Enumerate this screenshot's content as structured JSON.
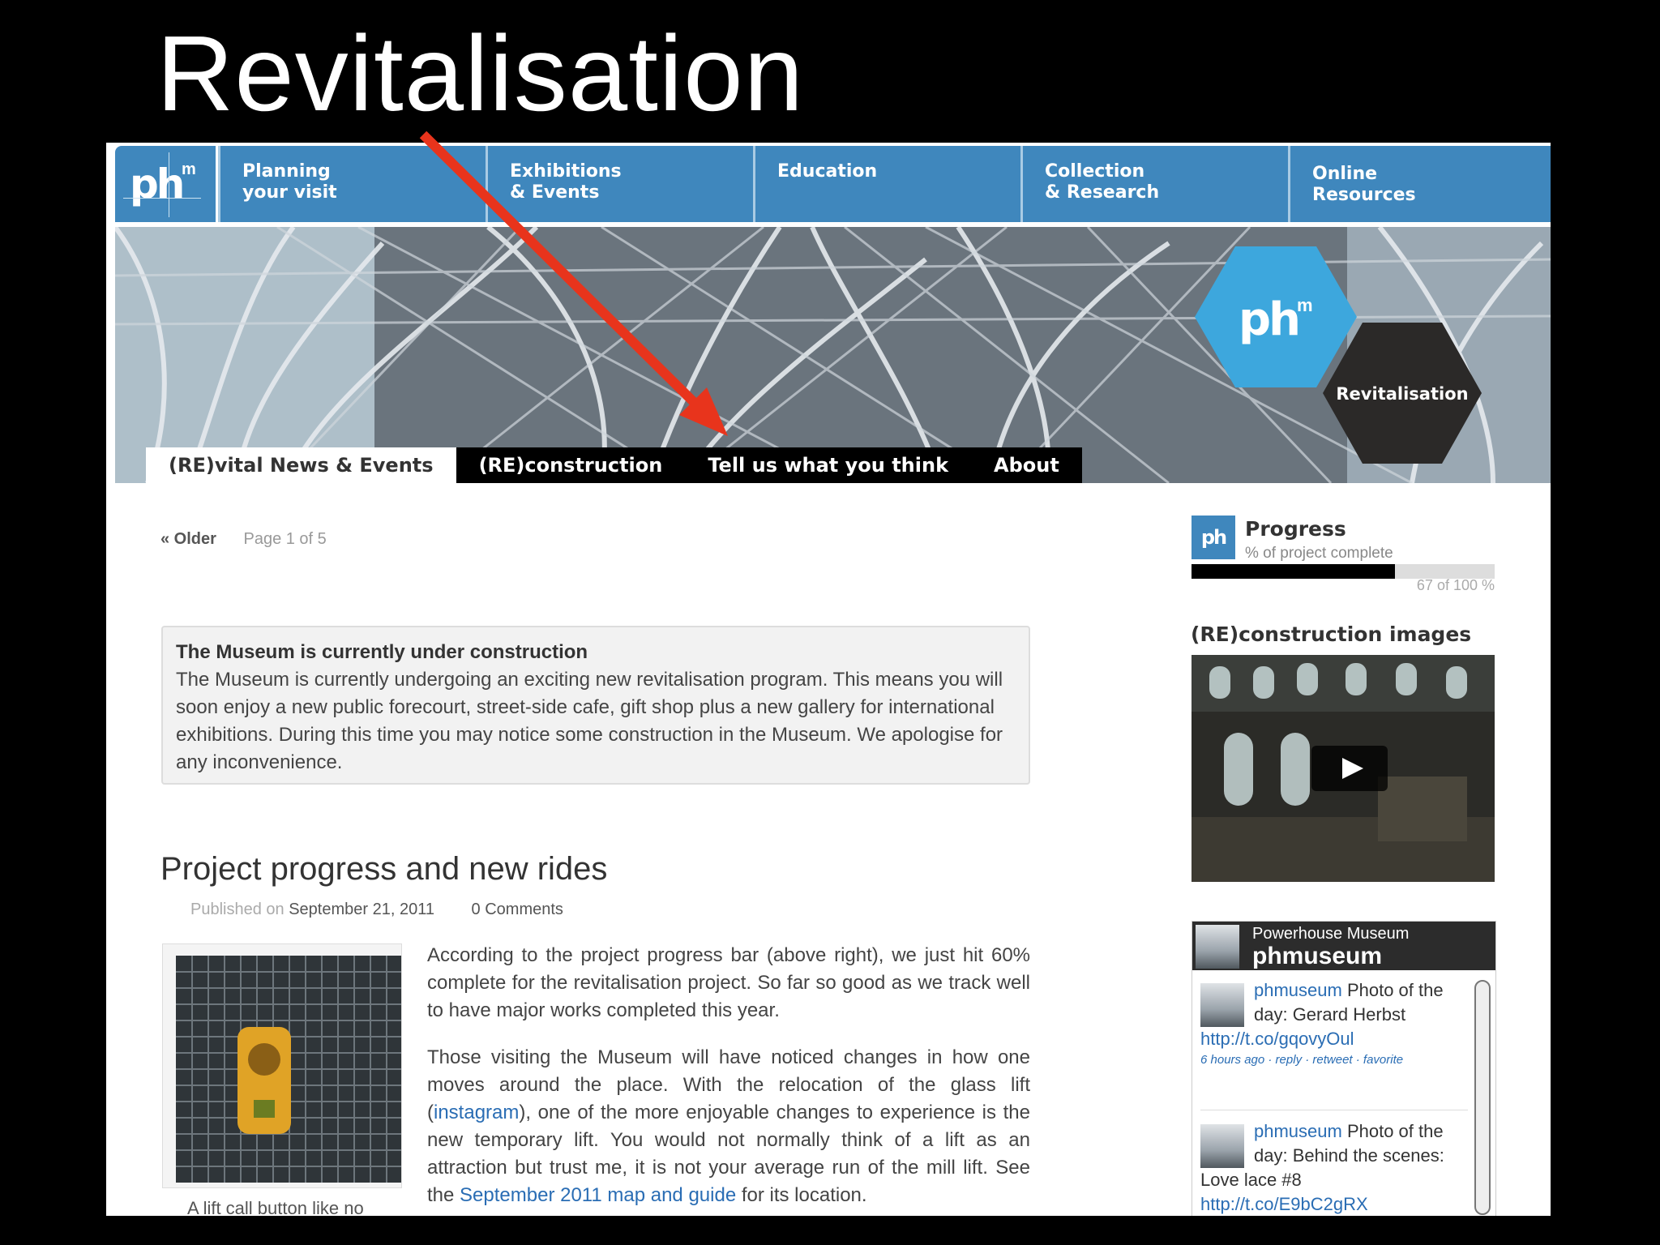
{
  "slide": {
    "title": "Revitalisation"
  },
  "nav": {
    "logo": {
      "text": "ph",
      "sup": "m"
    },
    "items": [
      {
        "label": "Planning\nyour visit"
      },
      {
        "label": "Exhibitions\n& Events"
      },
      {
        "label": "Education"
      },
      {
        "label": "Collection\n& Research"
      },
      {
        "label": "Online\nResources"
      }
    ]
  },
  "hero": {
    "logo": {
      "text": "ph",
      "sup": "m"
    },
    "badge": "Revitalisation",
    "tabs": [
      {
        "label": "(RE)vital News & Events",
        "active": true
      },
      {
        "label": "(RE)construction"
      },
      {
        "label": "Tell us what you think"
      },
      {
        "label": "About"
      }
    ]
  },
  "pager": {
    "older": "« Older",
    "page": "Page 1 of 5"
  },
  "notice": {
    "title": "The Museum is currently under construction",
    "body": "The Museum is currently undergoing an exciting new revitalisation program. This means you will soon enjoy a new public forecourt, street-side cafe, gift shop plus a new gallery for international exhibitions. During this time you may notice some construction in the Museum. We apologise for any inconvenience."
  },
  "post": {
    "title": "Project progress and new rides",
    "published_label": "Published on",
    "date": "September 21, 2011",
    "comments": "0 Comments",
    "caption": "A lift call button like no",
    "p1": "According to the project progress bar (above right), we just hit 60% complete for the revitalisation project. So far so good as we track well to have major works completed this year.",
    "p2_a": "Those visiting the Museum will have noticed changes in how one moves around the place. With the relocation of the glass lift (",
    "p2_link1": "instagram",
    "p2_b": "), one of the more enjoyable changes to experience is the new temporary lift. You would not normally think of a lift as an attraction but trust me, it is not your average run of the mill lift. See the ",
    "p2_link2": "September 2011 map and guide",
    "p2_c": " for its location."
  },
  "progress": {
    "logo": "ph",
    "title": "Progress",
    "subtitle": "% of project complete",
    "value": 67,
    "max": 100,
    "label": "67 of 100 %"
  },
  "reconstruction": {
    "title": "(RE)construction images"
  },
  "twitter": {
    "account_name": "Powerhouse Museum",
    "handle": "phmuseum",
    "tweets": [
      {
        "user": "phmuseum",
        "text": " Photo of the day: Gerard Herbst ",
        "link": "http://t.co/gqovyOul",
        "meta": "6 hours ago · reply · retweet · favorite"
      },
      {
        "user": "phmuseum",
        "text": " Photo of the day: Behind the scenes: Love lace #8 ",
        "link": "http://t.co/E9bC2gRX"
      }
    ]
  },
  "colors": {
    "nav_blue": "#3f87bd",
    "hero_logo_blue": "#3da7dd",
    "arrow_red": "#e8341c",
    "link": "#2a6db4"
  }
}
